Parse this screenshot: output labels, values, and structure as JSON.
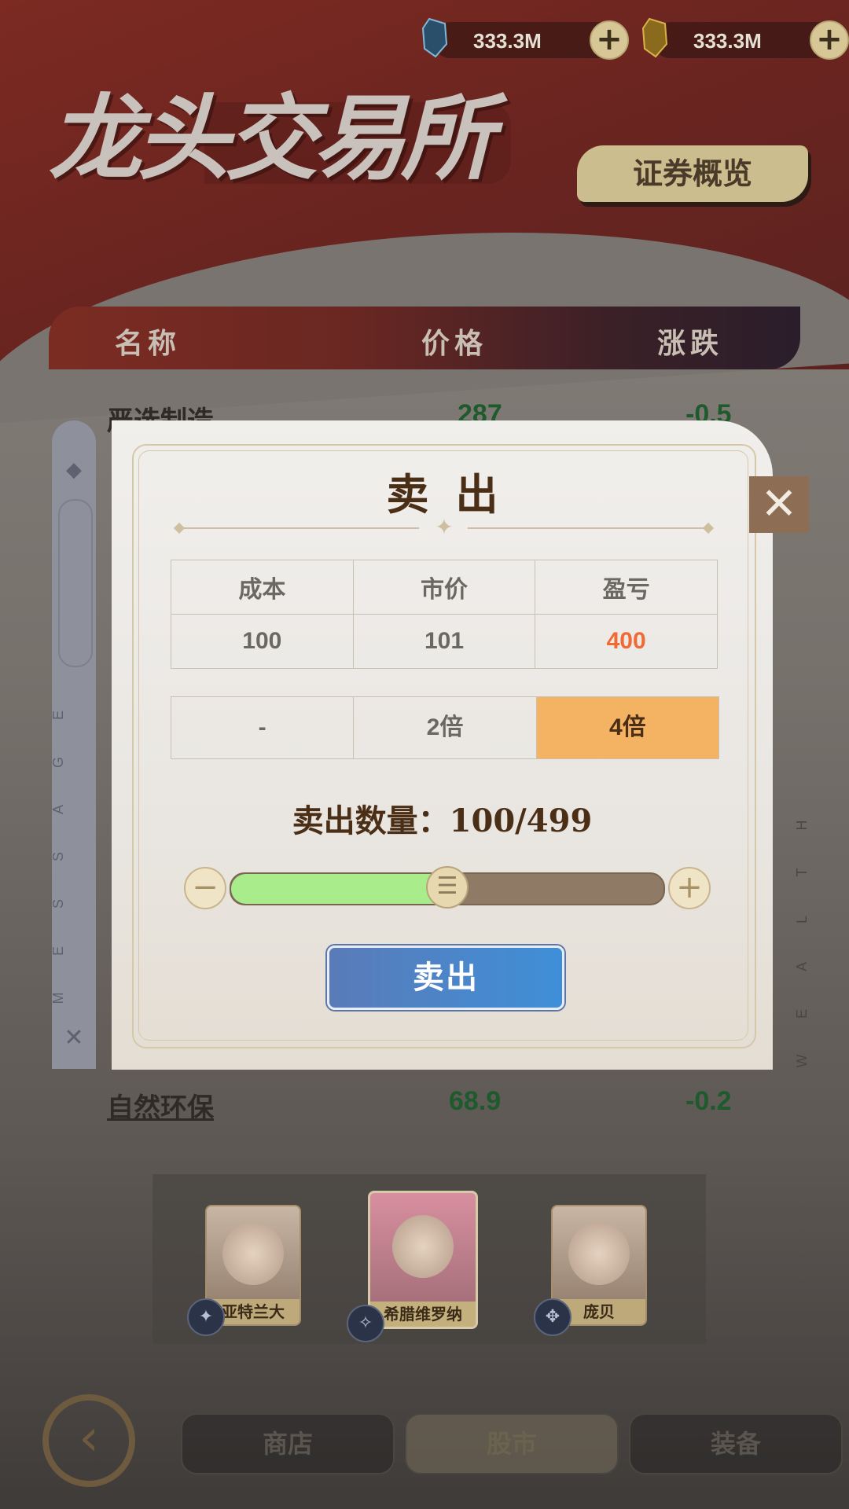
{
  "currency": [
    {
      "amount": "333.3M",
      "gem": "blue-crystal-icon",
      "plus": "+"
    },
    {
      "amount": "333.3M",
      "gem": "gold-crystal-icon",
      "plus": "+"
    }
  ],
  "header": {
    "logo_title": "龙头交易所",
    "overview_button": "证券概览"
  },
  "stock_table": {
    "columns": [
      "名称",
      "价格",
      "涨跌"
    ],
    "rows": [
      {
        "name": "严选制造",
        "price": "287",
        "change": "-0.5"
      },
      {
        "name": "自然环保",
        "price": "68.9",
        "change": "-0.2"
      }
    ]
  },
  "sidebar": {
    "message_letters": [
      "M",
      "E",
      "S",
      "S",
      "A",
      "G",
      "E"
    ],
    "wealth_letters": [
      "W",
      "E",
      "A",
      "L",
      "T",
      "H"
    ]
  },
  "characters": [
    {
      "name": "亚特兰大",
      "selected": false
    },
    {
      "name": "希腊维罗纳",
      "selected": true
    },
    {
      "name": "庞贝",
      "selected": false
    }
  ],
  "nav": {
    "back": "‹",
    "items": [
      "商店",
      "股市",
      "装备"
    ],
    "active_index": 1
  },
  "dialog": {
    "title": "卖出",
    "close": "✕",
    "info_headers": [
      "成本",
      "市价",
      "盈亏"
    ],
    "info_values": [
      "100",
      "101",
      "400"
    ],
    "multipliers": [
      "-",
      "2倍",
      "4倍"
    ],
    "selected_multiplier": "4倍",
    "quantity_label": "卖出数量：100/499",
    "quantity": 100,
    "quantity_max": 499,
    "slider_fill_percent": 50,
    "minus": "−",
    "plus": "+",
    "thumb": "☰",
    "sell_button": "卖出"
  },
  "colors": {
    "loss_text": "#f06a35",
    "selected_multiplier": "#f4b263",
    "sell_button": "#4a86cc",
    "price_text": "#1e5a2c"
  }
}
